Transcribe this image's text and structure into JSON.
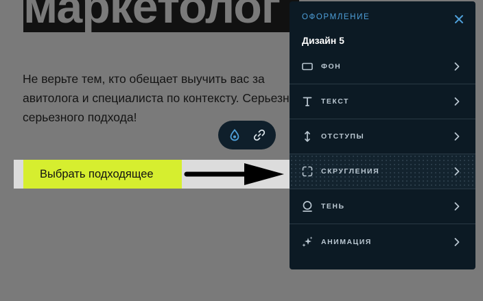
{
  "heading": {
    "text": "маркетолог"
  },
  "paragraph": {
    "lines": [
      "Не верьте тем, кто обещает выучить вас за",
      "авитолога и специалиста по контексту. Серьезная",
      "серьезного подхода!"
    ]
  },
  "mini_toolbar": {
    "buttons": [
      {
        "icon": "droplet-icon"
      },
      {
        "icon": "link-icon"
      }
    ]
  },
  "cta": {
    "label": "Выбрать подходящее"
  },
  "panel": {
    "header": "ОФОРМЛЕНИЕ",
    "subtitle": "Дизайн 5",
    "close_icon": "close-icon",
    "accent_color": "#4e9fd9",
    "background_color": "#0c1a24",
    "items": [
      {
        "label": "ФОН",
        "icon": "rectangle-icon",
        "active": false
      },
      {
        "label": "ТЕКСТ",
        "icon": "text-icon",
        "active": false
      },
      {
        "label": "ОТСТУПЫ",
        "icon": "vertical-arrows-icon",
        "active": false
      },
      {
        "label": "СКРУГЛЕНИЯ",
        "icon": "corners-icon",
        "active": true
      },
      {
        "label": "ТЕНЬ",
        "icon": "shadow-icon",
        "active": false
      },
      {
        "label": "АНИМАЦИЯ",
        "icon": "sparkle-icon",
        "active": false
      }
    ]
  },
  "colors": {
    "cta_background": "#d6ee2f",
    "overlay_background": "#7a7a7a"
  }
}
